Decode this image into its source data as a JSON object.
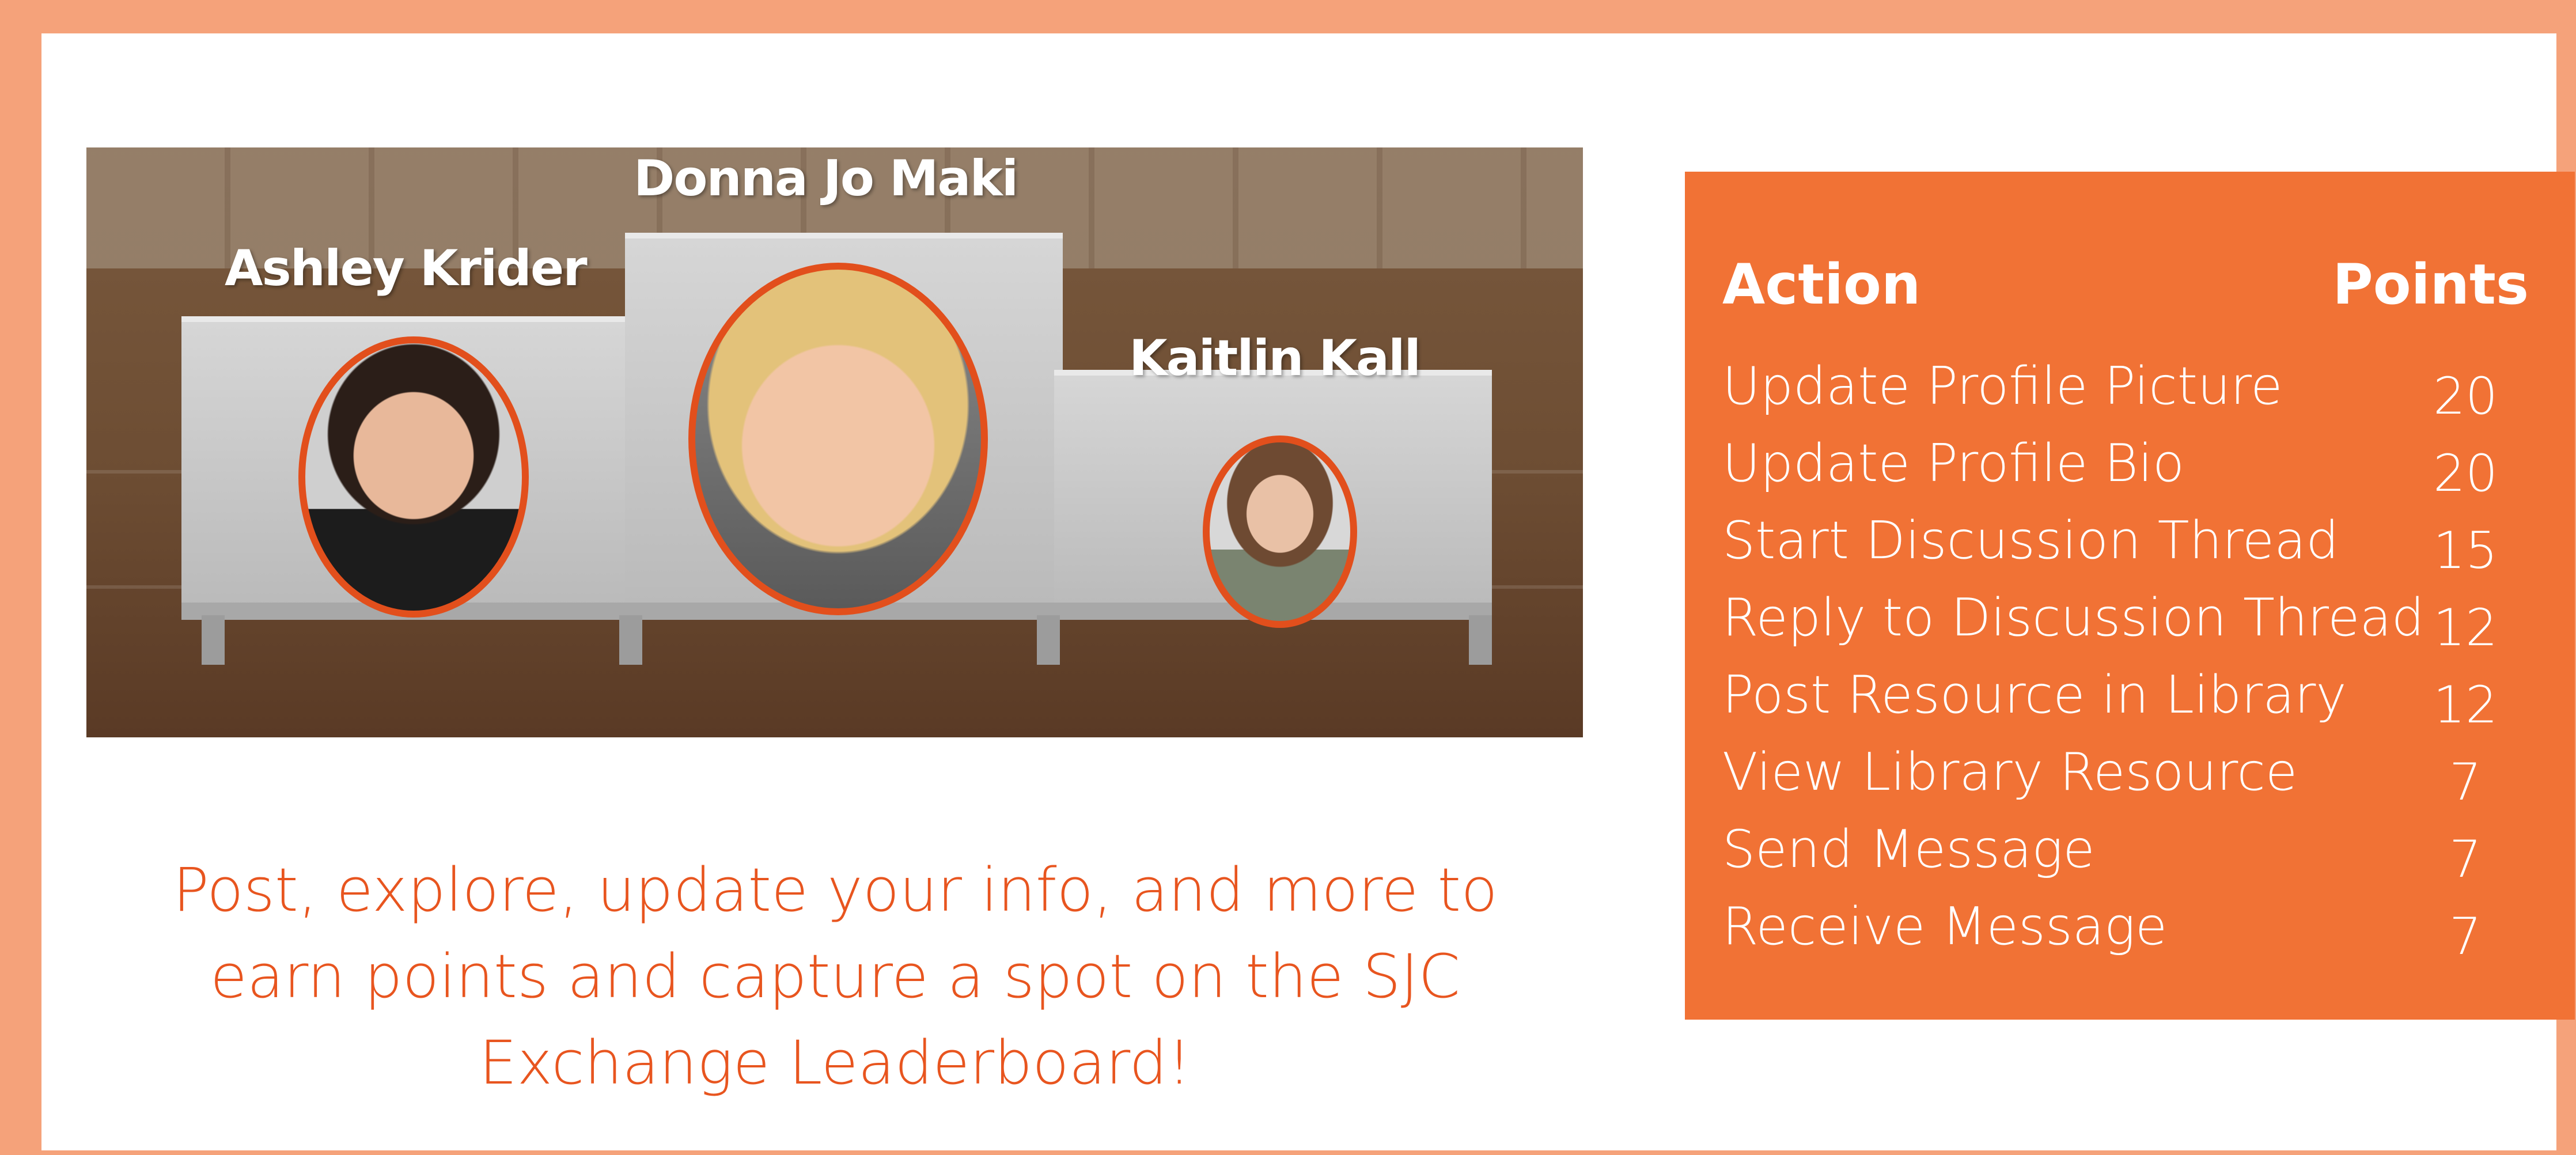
{
  "podium": {
    "names": {
      "left": "Ashley Krider",
      "center": "Donna Jo Maki",
      "right": "Kaitlin Kall"
    }
  },
  "tagline": "Post, explore, update your info, and more to earn points and capture a spot on the SJC Exchange Leaderboard!",
  "points_table": {
    "header_action": "Action",
    "header_points": "Points",
    "rows": [
      {
        "action": "Update Profile Picture",
        "points": "20"
      },
      {
        "action": "Update Profile Bio",
        "points": "20"
      },
      {
        "action": "Start Discussion Thread",
        "points": "15"
      },
      {
        "action": "Reply to Discussion Thread",
        "points": "12"
      },
      {
        "action": "Post Resource in Library",
        "points": "12"
      },
      {
        "action": "View Library Resource",
        "points": "7"
      },
      {
        "action": "Send Message",
        "points": "7"
      },
      {
        "action": "Receive Message",
        "points": "7"
      }
    ]
  },
  "colors": {
    "frame": "#f5a27a",
    "panel": "#f17235",
    "tagline": "#e8551f",
    "avatar_ring": "#e24f1c"
  }
}
